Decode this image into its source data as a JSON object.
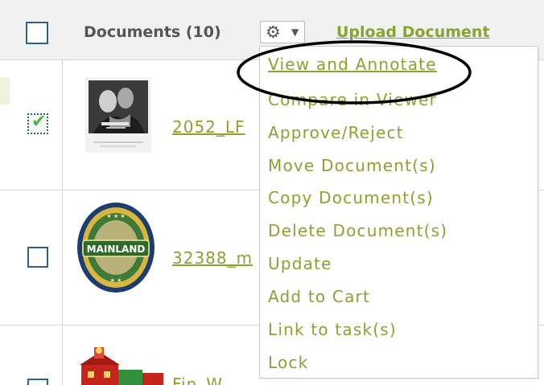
{
  "header": {
    "title": "Documents (10)",
    "upload_label": "Upload Document"
  },
  "rows": [
    {
      "selected": true,
      "doc_label": "2052_LF"
    },
    {
      "selected": false,
      "doc_label": "32388_m"
    },
    {
      "selected": false,
      "doc_label": "Fin_W..."
    }
  ],
  "thumbnails": {
    "badge_text": "MAINLAND"
  },
  "menu": {
    "items": [
      {
        "label": "View and Annotate",
        "highlighted": true
      },
      {
        "label": "Compare in Viewer"
      },
      {
        "label": "Approve/Reject"
      },
      {
        "label": "Move Document(s)"
      },
      {
        "label": "Copy Document(s)"
      },
      {
        "label": "Delete Document(s)"
      },
      {
        "label": "Update"
      },
      {
        "label": "Add to Cart"
      },
      {
        "label": "Link to task(s)"
      },
      {
        "label": "Lock"
      }
    ]
  },
  "colors": {
    "link": "#8aa330",
    "checkbox_border": "#2c5f92",
    "checkmark": "#4caf50",
    "header_bg": "#f1f1f1"
  },
  "icons": {
    "actions": "gear-icon",
    "actions_caret": "chevron-down-icon",
    "checkmark": "check-icon"
  }
}
